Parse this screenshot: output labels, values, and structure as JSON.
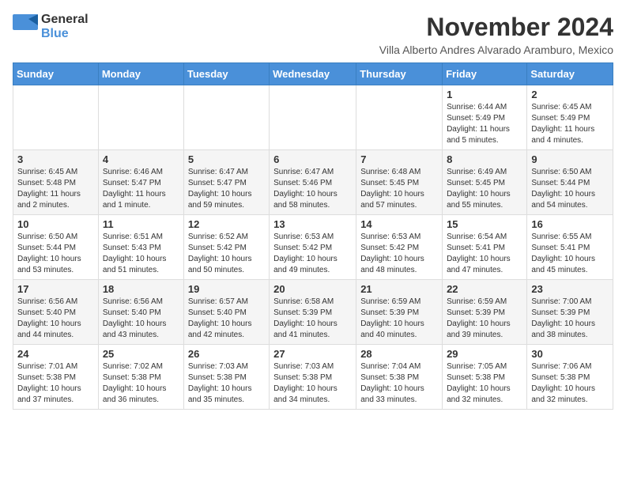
{
  "logo": {
    "general": "General",
    "blue": "Blue"
  },
  "title": "November 2024",
  "location": "Villa Alberto Andres Alvarado Aramburo, Mexico",
  "days_of_week": [
    "Sunday",
    "Monday",
    "Tuesday",
    "Wednesday",
    "Thursday",
    "Friday",
    "Saturday"
  ],
  "weeks": [
    [
      {
        "day": "",
        "info": ""
      },
      {
        "day": "",
        "info": ""
      },
      {
        "day": "",
        "info": ""
      },
      {
        "day": "",
        "info": ""
      },
      {
        "day": "",
        "info": ""
      },
      {
        "day": "1",
        "info": "Sunrise: 6:44 AM\nSunset: 5:49 PM\nDaylight: 11 hours and 5 minutes."
      },
      {
        "day": "2",
        "info": "Sunrise: 6:45 AM\nSunset: 5:49 PM\nDaylight: 11 hours and 4 minutes."
      }
    ],
    [
      {
        "day": "3",
        "info": "Sunrise: 6:45 AM\nSunset: 5:48 PM\nDaylight: 11 hours and 2 minutes."
      },
      {
        "day": "4",
        "info": "Sunrise: 6:46 AM\nSunset: 5:47 PM\nDaylight: 11 hours and 1 minute."
      },
      {
        "day": "5",
        "info": "Sunrise: 6:47 AM\nSunset: 5:47 PM\nDaylight: 10 hours and 59 minutes."
      },
      {
        "day": "6",
        "info": "Sunrise: 6:47 AM\nSunset: 5:46 PM\nDaylight: 10 hours and 58 minutes."
      },
      {
        "day": "7",
        "info": "Sunrise: 6:48 AM\nSunset: 5:45 PM\nDaylight: 10 hours and 57 minutes."
      },
      {
        "day": "8",
        "info": "Sunrise: 6:49 AM\nSunset: 5:45 PM\nDaylight: 10 hours and 55 minutes."
      },
      {
        "day": "9",
        "info": "Sunrise: 6:50 AM\nSunset: 5:44 PM\nDaylight: 10 hours and 54 minutes."
      }
    ],
    [
      {
        "day": "10",
        "info": "Sunrise: 6:50 AM\nSunset: 5:44 PM\nDaylight: 10 hours and 53 minutes."
      },
      {
        "day": "11",
        "info": "Sunrise: 6:51 AM\nSunset: 5:43 PM\nDaylight: 10 hours and 51 minutes."
      },
      {
        "day": "12",
        "info": "Sunrise: 6:52 AM\nSunset: 5:42 PM\nDaylight: 10 hours and 50 minutes."
      },
      {
        "day": "13",
        "info": "Sunrise: 6:53 AM\nSunset: 5:42 PM\nDaylight: 10 hours and 49 minutes."
      },
      {
        "day": "14",
        "info": "Sunrise: 6:53 AM\nSunset: 5:42 PM\nDaylight: 10 hours and 48 minutes."
      },
      {
        "day": "15",
        "info": "Sunrise: 6:54 AM\nSunset: 5:41 PM\nDaylight: 10 hours and 47 minutes."
      },
      {
        "day": "16",
        "info": "Sunrise: 6:55 AM\nSunset: 5:41 PM\nDaylight: 10 hours and 45 minutes."
      }
    ],
    [
      {
        "day": "17",
        "info": "Sunrise: 6:56 AM\nSunset: 5:40 PM\nDaylight: 10 hours and 44 minutes."
      },
      {
        "day": "18",
        "info": "Sunrise: 6:56 AM\nSunset: 5:40 PM\nDaylight: 10 hours and 43 minutes."
      },
      {
        "day": "19",
        "info": "Sunrise: 6:57 AM\nSunset: 5:40 PM\nDaylight: 10 hours and 42 minutes."
      },
      {
        "day": "20",
        "info": "Sunrise: 6:58 AM\nSunset: 5:39 PM\nDaylight: 10 hours and 41 minutes."
      },
      {
        "day": "21",
        "info": "Sunrise: 6:59 AM\nSunset: 5:39 PM\nDaylight: 10 hours and 40 minutes."
      },
      {
        "day": "22",
        "info": "Sunrise: 6:59 AM\nSunset: 5:39 PM\nDaylight: 10 hours and 39 minutes."
      },
      {
        "day": "23",
        "info": "Sunrise: 7:00 AM\nSunset: 5:39 PM\nDaylight: 10 hours and 38 minutes."
      }
    ],
    [
      {
        "day": "24",
        "info": "Sunrise: 7:01 AM\nSunset: 5:38 PM\nDaylight: 10 hours and 37 minutes."
      },
      {
        "day": "25",
        "info": "Sunrise: 7:02 AM\nSunset: 5:38 PM\nDaylight: 10 hours and 36 minutes."
      },
      {
        "day": "26",
        "info": "Sunrise: 7:03 AM\nSunset: 5:38 PM\nDaylight: 10 hours and 35 minutes."
      },
      {
        "day": "27",
        "info": "Sunrise: 7:03 AM\nSunset: 5:38 PM\nDaylight: 10 hours and 34 minutes."
      },
      {
        "day": "28",
        "info": "Sunrise: 7:04 AM\nSunset: 5:38 PM\nDaylight: 10 hours and 33 minutes."
      },
      {
        "day": "29",
        "info": "Sunrise: 7:05 AM\nSunset: 5:38 PM\nDaylight: 10 hours and 32 minutes."
      },
      {
        "day": "30",
        "info": "Sunrise: 7:06 AM\nSunset: 5:38 PM\nDaylight: 10 hours and 32 minutes."
      }
    ]
  ]
}
